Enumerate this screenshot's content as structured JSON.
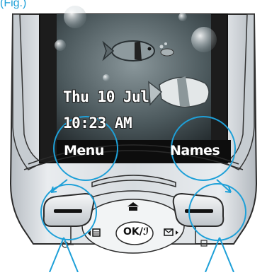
{
  "caption": "(Fig.)",
  "screen": {
    "date": "Thu 10 Jul",
    "time": "10:23 AM",
    "left_soft_key_label": "Menu",
    "right_soft_key_label": "Names"
  },
  "keypad": {
    "center_key_label": "OK/ℐ",
    "up_key_icon": "phonebook-icon",
    "left_key_icon": "shortcut-icon",
    "right_key_icon": "message-icon"
  },
  "colors": {
    "callout": "#1ea0d8",
    "screen_bg": "#3c4a4e",
    "softkey_bar": "#0d0d0d",
    "phone_body": "#cfd4d9"
  }
}
